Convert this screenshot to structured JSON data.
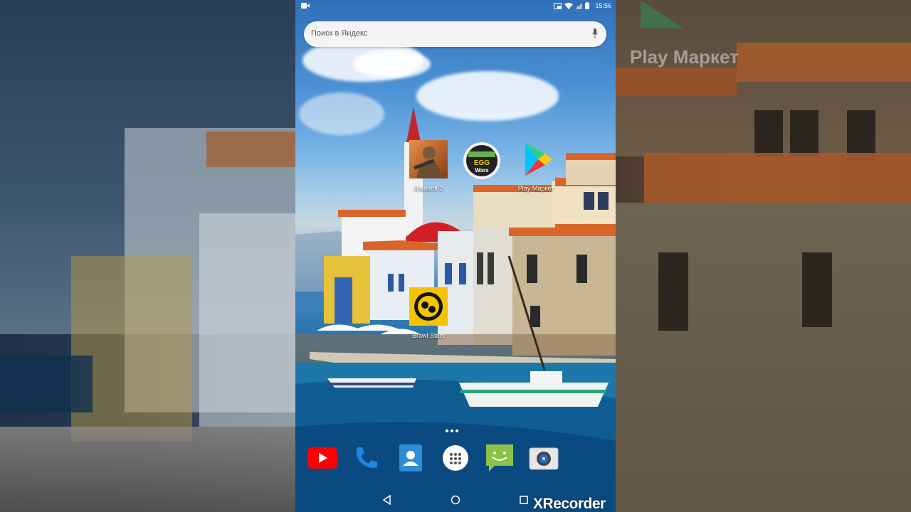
{
  "status_bar": {
    "time": "15:56",
    "icons": [
      "screen-record-icon",
      "cast-icon",
      "wifi-icon",
      "signal-icon",
      "battery-icon"
    ]
  },
  "search": {
    "placeholder": "Поиск в Яндекс",
    "icon": "mic-icon"
  },
  "home_apps": [
    {
      "label": "Standoff 2",
      "icon": "standoff2-icon"
    },
    {
      "label": "",
      "icon": "egg-wars-icon"
    },
    {
      "label": "Play Маркет",
      "icon": "play-market-icon"
    },
    {
      "label": "Brawl Stars",
      "icon": "brawl-stars-icon"
    }
  ],
  "dock": [
    {
      "icon": "youtube-icon"
    },
    {
      "icon": "phone-icon"
    },
    {
      "icon": "contacts-icon"
    },
    {
      "icon": "app-drawer-icon"
    },
    {
      "icon": "messages-icon"
    },
    {
      "icon": "camera-icon"
    }
  ],
  "nav": {
    "icons": [
      "back-icon",
      "home-icon",
      "recents-icon"
    ]
  },
  "watermark": "XRecorder",
  "background_right": {
    "ghost_label": "Play Маркет"
  },
  "colors": {
    "youtube": "#ff0000",
    "phone": "#1e88e5",
    "contacts": "#2e8bd6",
    "messages": "#8bc34a",
    "brawl_yellow": "#f5c400"
  }
}
